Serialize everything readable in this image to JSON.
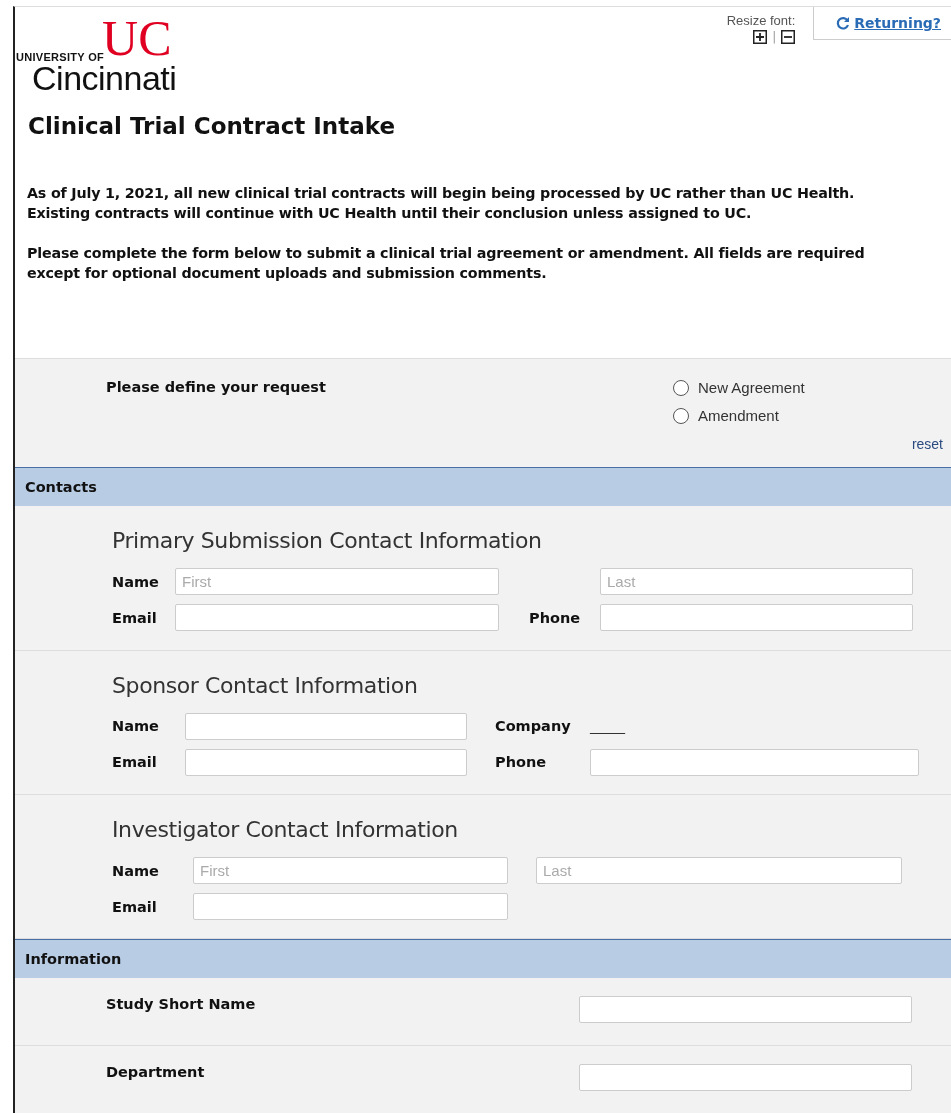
{
  "header": {
    "logo": {
      "mark": "UC",
      "top_line": "UNIVERSITY OF",
      "name": "Cincinnati"
    },
    "resize_font": {
      "label": "Resize font:",
      "separator": "|"
    },
    "returning_link": "Returning?"
  },
  "title": "Clinical Trial Contract Intake",
  "intro": [
    "As of July 1, 2021, all new clinical trial contracts will begin being processed by UC rather than UC Health. Existing contracts will continue with UC Health until their conclusion unless assigned to UC.",
    "Please complete the form below to submit a clinical trial agreement or amendment. All fields are required except for optional document uploads and submission comments."
  ],
  "request": {
    "label": "Please define your request",
    "options": [
      {
        "label": "New Agreement",
        "selected": false
      },
      {
        "label": "Amendment",
        "selected": false
      }
    ],
    "reset": "reset"
  },
  "contacts": {
    "heading": "Contacts",
    "groups": [
      {
        "title": "Primary Submission Contact Information",
        "rows": [
          {
            "label": "Name",
            "first": {
              "kind": "input",
              "placeholder": "First"
            },
            "second": {
              "kind": "input",
              "placeholder": "Last"
            }
          },
          {
            "label": "Email",
            "first": {
              "kind": "input"
            },
            "side_label": "Phone",
            "second": {
              "kind": "input"
            }
          }
        ]
      },
      {
        "title": "Sponsor Contact Information",
        "rows": [
          {
            "label": "Name",
            "first": {
              "kind": "input"
            },
            "side_label": "Company",
            "second": {
              "kind": "text",
              "value": "_____"
            }
          },
          {
            "label": "Email",
            "first": {
              "kind": "input"
            },
            "side_label": "Phone",
            "second": {
              "kind": "input"
            }
          }
        ]
      },
      {
        "title": "Investigator Contact Information",
        "rows": [
          {
            "label": "Name",
            "first": {
              "kind": "input",
              "placeholder": "First"
            },
            "second": {
              "kind": "input",
              "placeholder": "Last"
            }
          },
          {
            "label": "Email",
            "first": {
              "kind": "input"
            }
          }
        ]
      }
    ]
  },
  "information": {
    "heading": "Information",
    "rows": [
      {
        "label": "Study Short Name"
      },
      {
        "label": "Department"
      }
    ]
  }
}
